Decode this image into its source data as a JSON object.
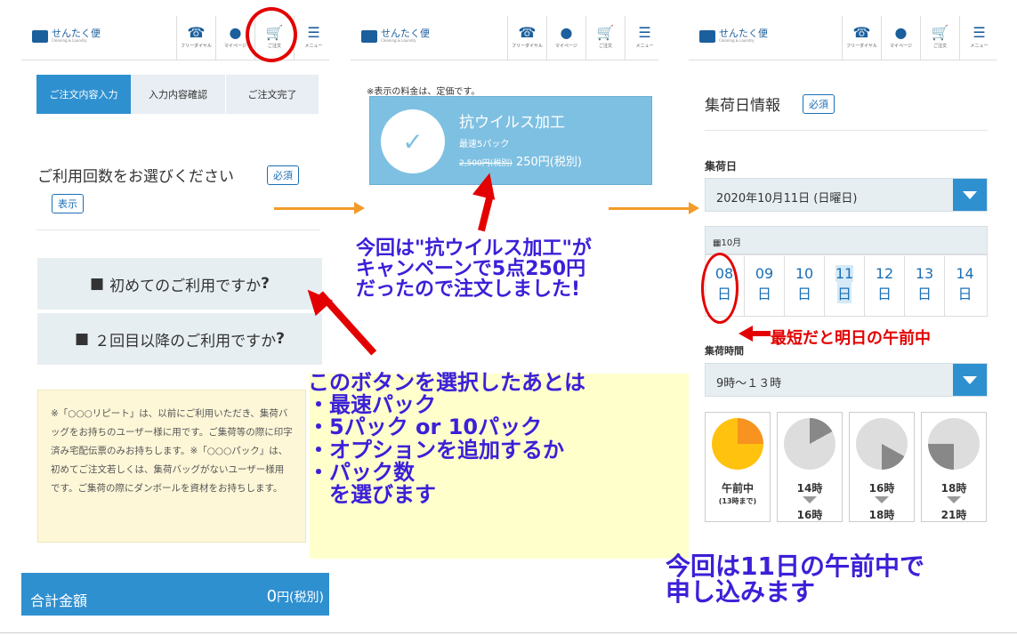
{
  "panel1": {
    "logo_title": "せんたく便",
    "logo_sub": "Cleaning & Laundry",
    "header": {
      "free": "フリーダイヤル",
      "mypage": "マイページ",
      "order": "ご注文",
      "menu": "メニュー"
    },
    "steps": [
      "ご注文内容入力",
      "入力内容確認",
      "ご注文完了"
    ],
    "question": "ご利用回数をお選びください",
    "required": "必須",
    "display": "表示",
    "btn_first": "初めてのご利用ですか",
    "btn_repeat": "２回目以降のご利用ですか",
    "qmark": "?",
    "note": "※「○○○リピート」は、以前にご利用いただき、集荷バッグをお持ちのユーザー様に用です。ご集荷等の際に印字済み宅配伝票のみお持ちします。※「○○○パック」は、初めてご注文若しくは、集荷バッグがないユーザー様用です。ご集荷の際にダンボールを資材をお持ちします。",
    "total_label": "合計金額",
    "total_value": "0",
    "total_unit": "円(税別)"
  },
  "panel2": {
    "logo_title": "せんたく便",
    "logo_sub": "Cleaning & Laundry",
    "header": {
      "free": "フリーダイヤル",
      "mypage": "マイページ",
      "order": "ご注文",
      "menu": "メニュー"
    },
    "price_note": "※表示の料金は、定価です。",
    "card_title": "抗ウイルス加工",
    "card_sub": "最速5パック",
    "card_old": "2,500円(税別)",
    "card_price": "250円(税別)"
  },
  "panel3": {
    "logo_title": "せんたく便",
    "logo_sub": "Cleaning & Laundry",
    "header": {
      "free": "フリーダイヤル",
      "mypage": "マイページ",
      "order": "ご注文",
      "menu": "メニュー"
    },
    "title": "集荷日情報",
    "required": "必須",
    "date_label": "集荷日",
    "date_value": "2020年10月11日 (日曜日)",
    "month": "10月",
    "days": [
      {
        "n": "08",
        "d": "日"
      },
      {
        "n": "09",
        "d": "日"
      },
      {
        "n": "10",
        "d": "日"
      },
      {
        "n": "11",
        "d": "日"
      },
      {
        "n": "12",
        "d": "日"
      },
      {
        "n": "13",
        "d": "日"
      },
      {
        "n": "14",
        "d": "日"
      }
    ],
    "time_label": "集荷時間",
    "time_value": "9時〜１３時",
    "slots": [
      {
        "a": "午前中",
        "b": "(13時まで)"
      },
      {
        "a": "14時",
        "b": "16時"
      },
      {
        "a": "16時",
        "b": "18時"
      },
      {
        "a": "18時",
        "b": "21時"
      }
    ]
  },
  "annotations": {
    "campaign": [
      "今回は\"抗ウイルス加工\"が",
      "キャンペーンで5点250円",
      "だったので注文しました!"
    ],
    "after": [
      "このボタンを選択したあとは",
      "・最速パック",
      "・5パック or 10パック",
      "・オプションを追加するか",
      "・パック数",
      "　を選びます"
    ],
    "earliest": "最短だと明日の午前中",
    "applied": [
      "今回は11日の午前中で",
      "申し込みます"
    ]
  }
}
